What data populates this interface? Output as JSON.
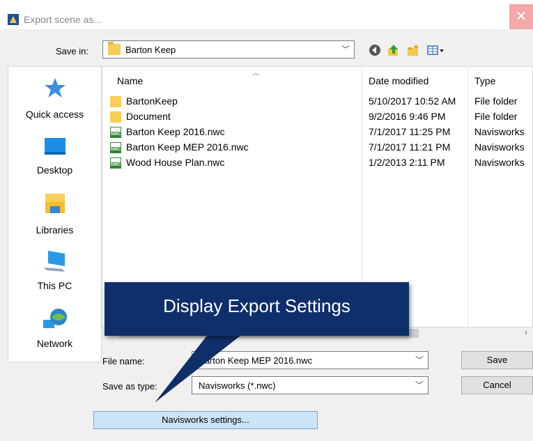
{
  "window": {
    "title": "Export scene as...",
    "close_glyph": "✕",
    "close_color": "#f3a9a9"
  },
  "toolbar": {
    "save_in_label": "Save in:",
    "save_in_value": "Barton Keep",
    "icons": [
      "back-icon",
      "up-folder-icon",
      "new-folder-icon",
      "view-menu-icon"
    ]
  },
  "places": [
    {
      "label": "Quick access",
      "icon": "star-icon"
    },
    {
      "label": "Desktop",
      "icon": "desktop-icon"
    },
    {
      "label": "Libraries",
      "icon": "libraries-icon"
    },
    {
      "label": "This PC",
      "icon": "computer-icon"
    },
    {
      "label": "Network",
      "icon": "network-icon"
    }
  ],
  "columns": {
    "name": "Name",
    "date": "Date modified",
    "type": "Type"
  },
  "files": [
    {
      "name": "BartonKeep",
      "date": "5/10/2017 10:52 AM",
      "type": "File folder",
      "kind": "folder"
    },
    {
      "name": "Document",
      "date": "9/2/2016 9:46 PM",
      "type": "File folder",
      "kind": "folder"
    },
    {
      "name": "Barton Keep 2016.nwc",
      "date": "7/1/2017 11:25 PM",
      "type": "Navisworks",
      "kind": "nwc"
    },
    {
      "name": "Barton Keep MEP 2016.nwc",
      "date": "7/1/2017 11:21 PM",
      "type": "Navisworks",
      "kind": "nwc"
    },
    {
      "name": "Wood House Plan.nwc",
      "date": "1/2/2013 2:11 PM",
      "type": "Navisworks",
      "kind": "nwc"
    }
  ],
  "nwc_badge": "NWC",
  "form": {
    "file_name_label": "File name:",
    "file_name_value": "Barton Keep MEP 2016.nwc",
    "save_as_type_label": "Save as type:",
    "save_as_type_value": "Navisworks (*.nwc)"
  },
  "buttons": {
    "save": "Save",
    "cancel": "Cancel",
    "navisworks_settings": "Navisworks settings..."
  },
  "callout": {
    "text": "Display Export Settings",
    "color": "#0f2f6b"
  }
}
